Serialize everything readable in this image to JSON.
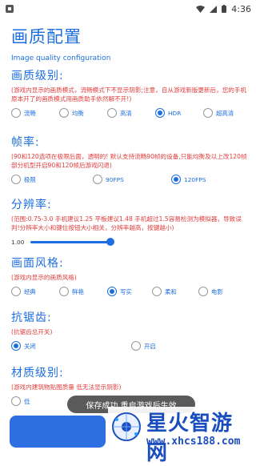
{
  "status_bar": {
    "time": "4:36"
  },
  "header": {
    "title": "画质配置",
    "subtitle": "Image quality configuration"
  },
  "sections": {
    "quality": {
      "title": "画质级别:",
      "desc": "(游戏内显示的画质模式，流畅模式下不显示阴影;注意，自从游戏新版更新后，您的手机原本开了的画质模式用画质助手依然解不开!)",
      "options": [
        "流畅",
        "均衡",
        "高清",
        "HDR",
        "超高清"
      ],
      "selected": "HDR"
    },
    "fps": {
      "title": "帧率:",
      "desc": "(90和120选项在极限后面，透明的! 默认支持流畅90帧的设备,只能均衡及以上改120帧 部分机型开启90和120帧后游戏闪退)",
      "options": [
        "极限",
        "90FPS",
        "120FPS"
      ],
      "selected": "120FPS"
    },
    "resolution": {
      "title": "分辨率:",
      "desc": "(范围:0.75-3.0 手机建议1.25 平板建议1.48 手机超过1.5容易检测为模拟器，导致误判!分辨率大小和键位按钮大小相关，分辨率越高，按键越小)",
      "value": "1.00"
    },
    "style": {
      "title": "画面风格:",
      "desc": "(游戏内显示的画质风格)",
      "options": [
        "经典",
        "鲜艳",
        "写实",
        "柔和",
        "电影"
      ],
      "selected": "写实"
    },
    "aa": {
      "title": "抗锯齿:",
      "desc": "(抗锯齿总开关)",
      "options": [
        "关闭",
        "开启"
      ],
      "selected": "关闭"
    },
    "material": {
      "title": "材质级别:",
      "desc": "(游戏内建筑物贴图质量 低无法显示阴影)",
      "options": [
        "低"
      ]
    }
  },
  "toast": "保存成功,重启游戏后生效",
  "watermark": {
    "title": "星火智游网",
    "url": "www.xhcs188.com"
  },
  "colors": {
    "accent": "#1d6fe0",
    "warning": "#e23b3b"
  }
}
